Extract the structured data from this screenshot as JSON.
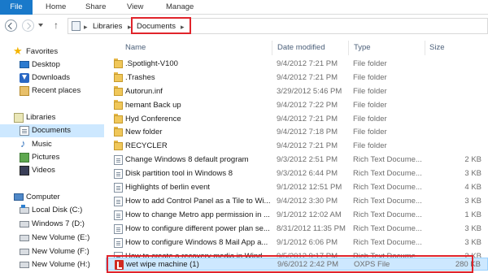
{
  "ribbon": {
    "tabs": [
      "File",
      "Home",
      "Share",
      "View",
      "Manage"
    ]
  },
  "address_bar": {
    "crumbs": [
      "Libraries",
      "Documents"
    ],
    "separator": "▸"
  },
  "columns": {
    "name": "Name",
    "date_modified": "Date modified",
    "type": "Type",
    "size": "Size"
  },
  "nav": {
    "favorites": {
      "header": "Favorites",
      "items": [
        "Desktop",
        "Downloads",
        "Recent places"
      ]
    },
    "libraries": {
      "header": "Libraries",
      "items": [
        "Documents",
        "Music",
        "Pictures",
        "Videos"
      ]
    },
    "computer": {
      "header": "Computer",
      "items": [
        "Local Disk (C:)",
        "Windows 7 (D:)",
        "New Volume (E:)",
        "New Volume (F:)",
        "New Volume (H:)"
      ]
    }
  },
  "files": [
    {
      "name": ".Spotlight-V100",
      "date": "9/4/2012 7:21 PM",
      "type": "File folder",
      "size": "",
      "icon": "folder-icon"
    },
    {
      "name": ".Trashes",
      "date": "9/4/2012 7:21 PM",
      "type": "File folder",
      "size": "",
      "icon": "folder-icon"
    },
    {
      "name": "Autorun.inf",
      "date": "3/29/2012 5:46 PM",
      "type": "File folder",
      "size": "",
      "icon": "folder-icon"
    },
    {
      "name": "hemant Back up",
      "date": "9/4/2012 7:22 PM",
      "type": "File folder",
      "size": "",
      "icon": "folder-icon"
    },
    {
      "name": "Hyd Conference",
      "date": "9/4/2012 7:21 PM",
      "type": "File folder",
      "size": "",
      "icon": "folder-icon"
    },
    {
      "name": "New folder",
      "date": "9/4/2012 7:18 PM",
      "type": "File folder",
      "size": "",
      "icon": "folder-icon"
    },
    {
      "name": "RECYCLER",
      "date": "9/4/2012 7:21 PM",
      "type": "File folder",
      "size": "",
      "icon": "folder-icon"
    },
    {
      "name": "Change Windows 8 default program",
      "date": "9/3/2012 2:51 PM",
      "type": "Rich Text Docume...",
      "size": "2 KB",
      "icon": "rtf-document-icon"
    },
    {
      "name": "Disk partition tool in Windows 8",
      "date": "9/3/2012 6:44 PM",
      "type": "Rich Text Docume...",
      "size": "3 KB",
      "icon": "rtf-document-icon"
    },
    {
      "name": "Highlights of berlin event",
      "date": "9/1/2012 12:51 PM",
      "type": "Rich Text Docume...",
      "size": "4 KB",
      "icon": "rtf-document-icon"
    },
    {
      "name": "How to add Control Panel as a Tile to Wi...",
      "date": "9/4/2012 3:30 PM",
      "type": "Rich Text Docume...",
      "size": "3 KB",
      "icon": "rtf-document-icon"
    },
    {
      "name": "How to change Metro app permission in ...",
      "date": "9/1/2012 12:02 AM",
      "type": "Rich Text Docume...",
      "size": "1 KB",
      "icon": "rtf-document-icon"
    },
    {
      "name": "How to configure different power plan se...",
      "date": "8/31/2012 11:35 PM",
      "type": "Rich Text Docume...",
      "size": "3 KB",
      "icon": "rtf-document-icon"
    },
    {
      "name": "How to configure Windows 8 Mail App a...",
      "date": "9/1/2012 6:06 PM",
      "type": "Rich Text Docume...",
      "size": "3 KB",
      "icon": "rtf-document-icon"
    },
    {
      "name": "How to create a recovery media in Wind...",
      "date": "9/5/2012 9:17 PM",
      "type": "Rich Text Docume...",
      "size": "2 KB",
      "icon": "rtf-document-icon"
    },
    {
      "name": "wet wipe machine (1)",
      "date": "9/6/2012 2:42 PM",
      "type": "OXPS File",
      "size": "280 KB",
      "icon": "oxps-document-icon",
      "selected": true
    }
  ],
  "colors": {
    "file_tab": "#1979ca",
    "selection": "#cde8ff",
    "highlight_box": "#e0242b",
    "column_header_text": "#4c607a"
  }
}
